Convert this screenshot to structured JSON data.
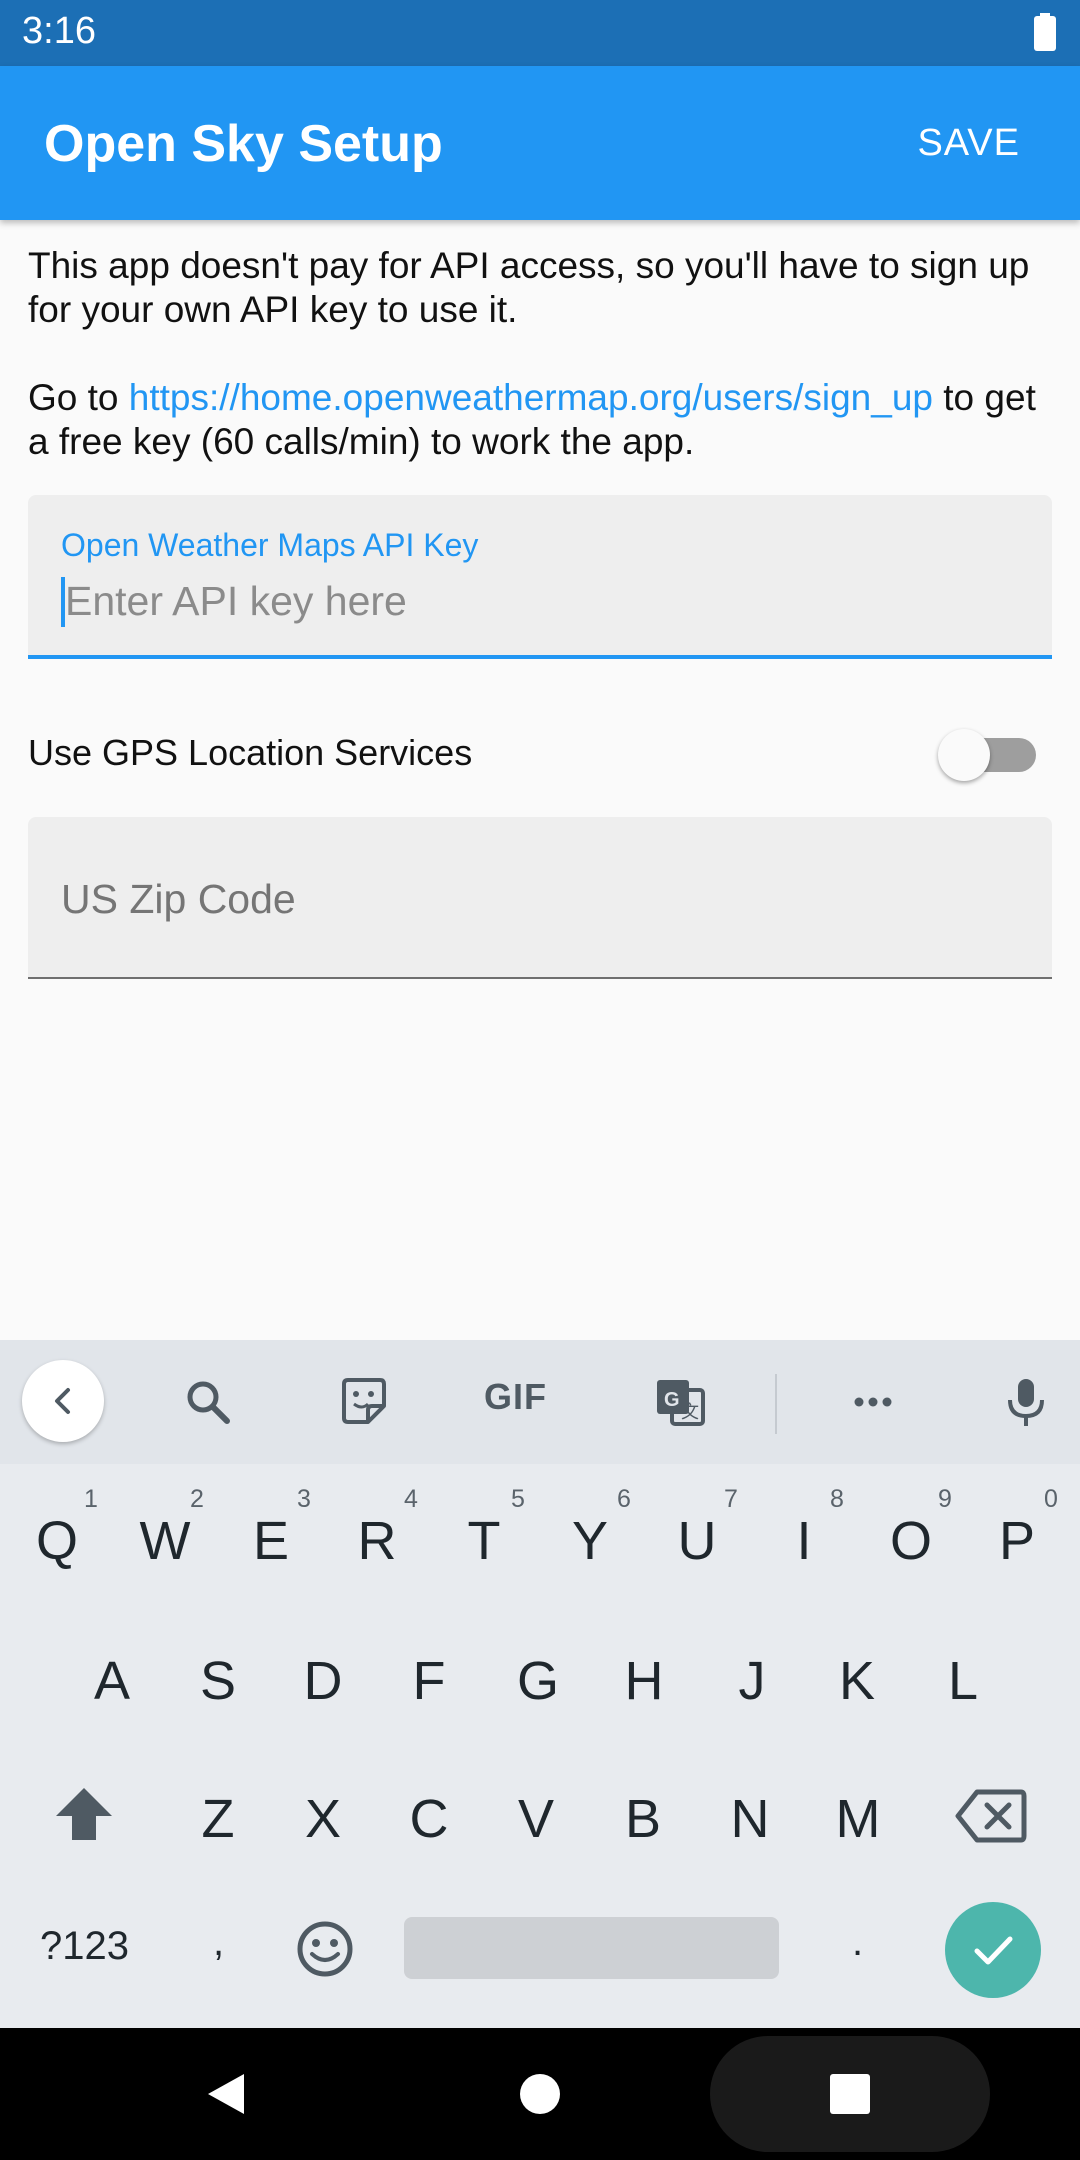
{
  "status_bar": {
    "time": "3:16",
    "battery_icon": "battery-full-icon"
  },
  "app_bar": {
    "title": "Open Sky Setup",
    "save_label": "SAVE",
    "color": "#2196f3",
    "status_color": "#1c6fb5"
  },
  "intro": {
    "paragraph1": "This app doesn't pay for API access, so you'll have to sign up for your own API key to use it.",
    "paragraph2_prefix": "Go to ",
    "paragraph2_link": "https://home.openweathermap.org/users/sign_up",
    "paragraph2_suffix": " to get a free key (60 calls/min) to work the app."
  },
  "api_key_field": {
    "label": "Open Weather Maps API Key",
    "placeholder": "Enter API key here",
    "value": "",
    "focused": true
  },
  "gps": {
    "label": "Use GPS Location Services",
    "enabled": false
  },
  "zip_field": {
    "placeholder": "US Zip Code",
    "value": ""
  },
  "keyboard": {
    "toolbar_icons": [
      "back-arrow-icon",
      "search-icon",
      "sticker-icon",
      "gif-icon",
      "translate-icon",
      "more-icon",
      "mic-icon"
    ],
    "gif_label": "GIF",
    "row1": [
      {
        "key": "Q",
        "hint": "1"
      },
      {
        "key": "W",
        "hint": "2"
      },
      {
        "key": "E",
        "hint": "3"
      },
      {
        "key": "R",
        "hint": "4"
      },
      {
        "key": "T",
        "hint": "5"
      },
      {
        "key": "Y",
        "hint": "6"
      },
      {
        "key": "U",
        "hint": "7"
      },
      {
        "key": "I",
        "hint": "8"
      },
      {
        "key": "O",
        "hint": "9"
      },
      {
        "key": "P",
        "hint": "0"
      }
    ],
    "row2": [
      "A",
      "S",
      "D",
      "F",
      "G",
      "H",
      "J",
      "K",
      "L"
    ],
    "row3": [
      "Z",
      "X",
      "C",
      "V",
      "B",
      "N",
      "M"
    ],
    "symbols_label": "?123",
    "comma": ",",
    "period": ".",
    "emoji_icon": "emoji-icon",
    "shift_icon": "shift-icon",
    "backspace_icon": "backspace-icon",
    "enter_icon": "check-icon",
    "enter_color": "#4db6ac"
  },
  "nav_bar": {
    "icons": [
      "back-triangle-icon",
      "home-circle-icon",
      "recents-square-icon"
    ]
  }
}
